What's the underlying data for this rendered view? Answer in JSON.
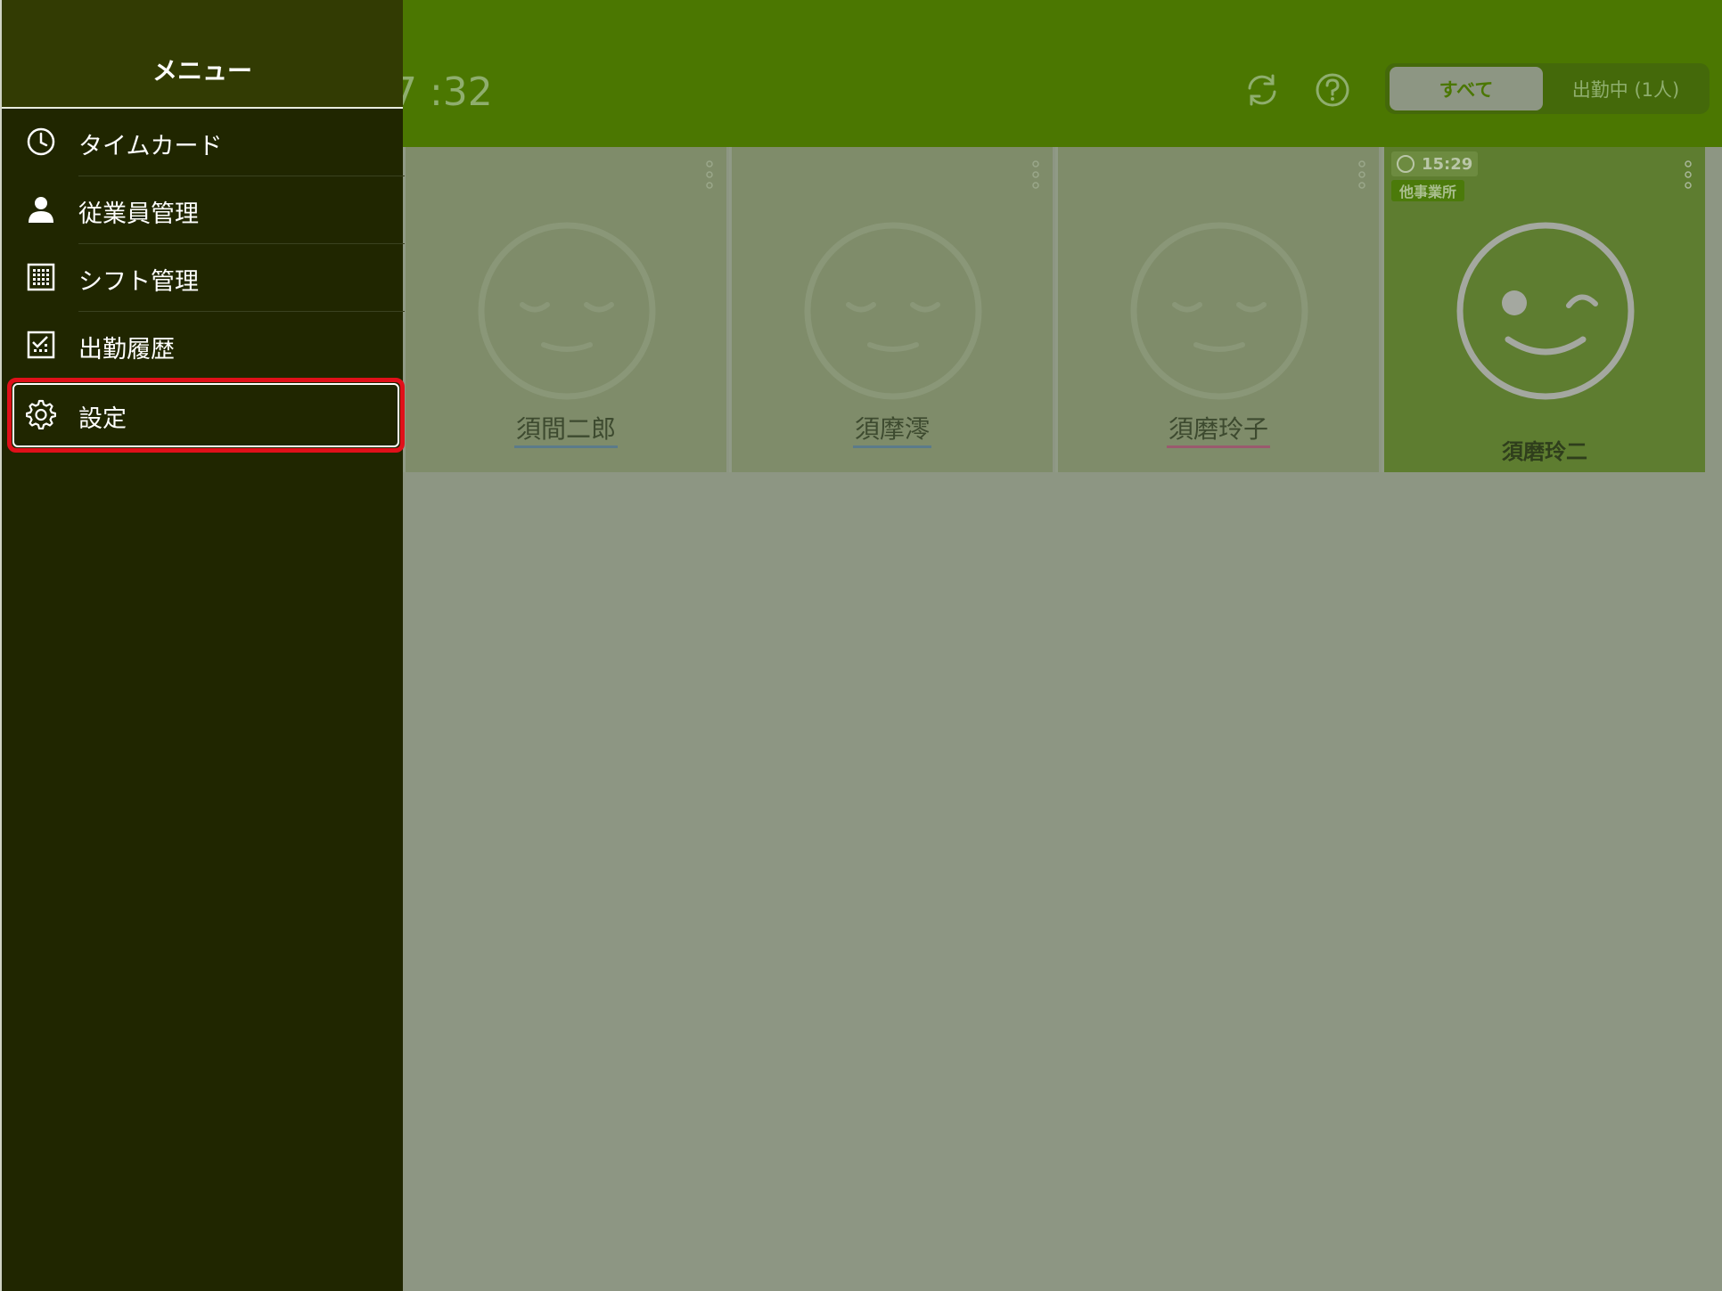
{
  "header": {
    "clock_partial": "7 :32",
    "segment": {
      "all": "すべて",
      "working": "出勤中 (1人)"
    }
  },
  "cards": [
    {
      "name": "須間二郎",
      "underline": "blue",
      "status": "off"
    },
    {
      "name": "須摩澪",
      "underline": "blue",
      "status": "off"
    },
    {
      "name": "須磨玲子",
      "underline": "pink",
      "status": "off"
    },
    {
      "name": "須磨玲二",
      "status": "on",
      "time": "15:29",
      "place": "他事業所"
    }
  ],
  "menu": {
    "title": "メニュー",
    "items": [
      {
        "label": "タイムカード",
        "icon": "clock-icon"
      },
      {
        "label": "従業員管理",
        "icon": "person-icon"
      },
      {
        "label": "シフト管理",
        "icon": "calendar-grid-icon"
      },
      {
        "label": "出勤履歴",
        "icon": "history-chart-icon"
      },
      {
        "label": "設定",
        "icon": "gear-icon"
      }
    ]
  },
  "colors": {
    "header_green": "#4b7701",
    "drawer_bg": "#202600",
    "highlight_red": "#e0101a"
  }
}
